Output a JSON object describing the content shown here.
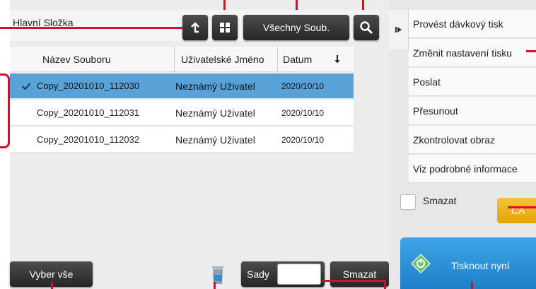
{
  "header": {
    "folder_title": "Hlavní Složka",
    "all_files_label": "Všechny Soub."
  },
  "table": {
    "columns": [
      "Název Souboru",
      "Uživatelské Jméno",
      "Datum"
    ],
    "rows": [
      {
        "name": "Copy_20201010_112030",
        "user": "Neznámý Uživatel",
        "date": "2020/10/10",
        "selected": true
      },
      {
        "name": "Copy_20201010_112031",
        "user": "Neznámý Uživatel",
        "date": "2020/10/10",
        "selected": false
      },
      {
        "name": "Copy_20201010_112032",
        "user": "Neznámý Uživatel",
        "date": "2020/10/10",
        "selected": false
      }
    ]
  },
  "bottom": {
    "select_all_label": "Vyber vše",
    "sets_label": "Sady",
    "sets_value": "",
    "delete_label": "Smazat"
  },
  "side_menu": {
    "items": [
      "Provést dávkový tisk",
      "Změnit nastavení tisku",
      "Poslat",
      "Přesunout",
      "Zkontrolovat obraz",
      "Viz podrobné informace"
    ],
    "delete_checkbox_label": "Smazat",
    "ca_label": "CA",
    "print_now_label": "Tisknout nyní"
  },
  "colors": {
    "callout": "#d0112b",
    "selected_row": "#59a2d8",
    "print_button": "#2a8fd8",
    "ca_button": "#efb21f"
  }
}
